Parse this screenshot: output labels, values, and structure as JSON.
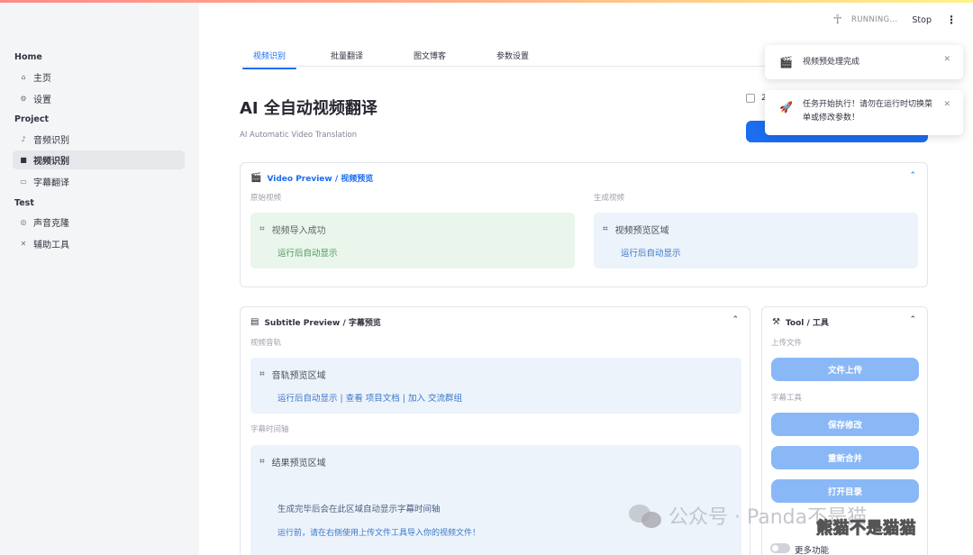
{
  "header": {
    "status_text": "RUNNING...",
    "stop_label": "Stop"
  },
  "sidebar": {
    "sections": [
      {
        "title": "Home",
        "items": [
          {
            "label": "主页",
            "icon": "home-icon"
          },
          {
            "label": "设置",
            "icon": "gear-icon"
          }
        ]
      },
      {
        "title": "Project",
        "items": [
          {
            "label": "音频识别",
            "icon": "audio-icon"
          },
          {
            "label": "视频识别",
            "icon": "video-icon"
          },
          {
            "label": "字幕翻译",
            "icon": "subtitle-icon"
          }
        ]
      },
      {
        "title": "Test",
        "items": [
          {
            "label": "声音克隆",
            "icon": "voice-clone-icon"
          },
          {
            "label": "辅助工具",
            "icon": "tools-icon"
          }
        ]
      }
    ],
    "active_item": "视频识别"
  },
  "tabs": [
    "视频识别",
    "批量翻译",
    "图文博客",
    "参数设置"
  ],
  "main": {
    "title": "AI 全自动视频翻译",
    "subtitle": "AI Automatic Video Translation",
    "checkbox_label": "2"
  },
  "video_preview": {
    "title": "Video Preview / 视频预览",
    "left_label": "原始视频",
    "right_label": "生成视频",
    "left_box": {
      "title": "视频导入成功",
      "body": "运行后自动显示"
    },
    "right_box": {
      "title": "视频预览区域",
      "body": "运行后自动显示"
    }
  },
  "subtitle_preview": {
    "title": "Subtitle Preview / 字幕预览",
    "track_label": "视频音轨",
    "track_box": {
      "title": "音轨预览区域",
      "body": "运行后自动显示 | 查看 项目文档 | 加入 交流群组"
    },
    "timeline_label": "字幕时间轴",
    "result_box": {
      "title": "结果预览区域",
      "line1": "生成完毕后会在此区域自动显示字幕时间轴",
      "line2": "运行前，请在右侧使用上传文件工具导入你的视频文件！"
    }
  },
  "tool": {
    "title": "Tool / 工具",
    "upload_label": "上传文件",
    "upload_button": "文件上传",
    "subtitle_tools_label": "字幕工具",
    "save_button": "保存修改",
    "merge_button": "重新合并",
    "open_dir_button": "打开目录",
    "more_label": "更多功能"
  },
  "toasts": [
    {
      "text": "视频预处理完成",
      "icon": "clapper-icon"
    },
    {
      "text": "任务开始执行！请勿在运行时切换菜单或修改参数！",
      "icon": "rocket-icon"
    }
  ],
  "watermark": {
    "text": "公众号 · Panda不是猫",
    "credit": "熊猫不是猫猫"
  },
  "colors": {
    "accent": "#1c6df0",
    "tool_button": "#8ab8f7",
    "success_bg": "#eaf6ec",
    "info_bg": "#edf3fb"
  }
}
